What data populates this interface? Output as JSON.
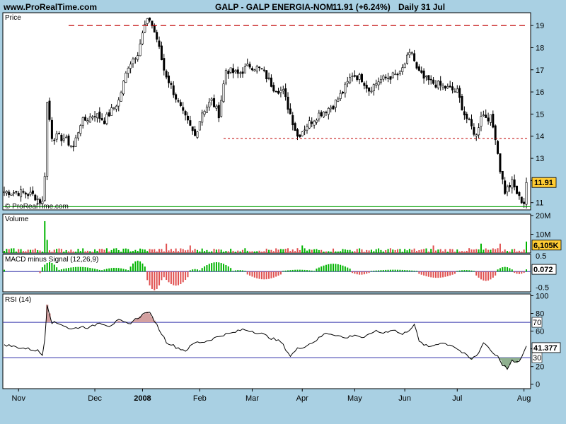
{
  "header": {
    "site": "www.ProRealTime.com",
    "title": "GALP - GALP ENERGIA-NOM",
    "price_change": "11.91 (+6.24%)",
    "period": "Daily  31 Jul"
  },
  "colors": {
    "background": "#a9d0e3",
    "panel": "#ffffff",
    "up": "#00b400",
    "down": "#e05050",
    "resistance": "#c00000",
    "support": "#00a000",
    "rsi_line": "#3333aa",
    "badge": "#ffcc33"
  },
  "chart_data": [
    {
      "type": "candlestick",
      "label": "Price",
      "credit": "© ProRealTime.com",
      "ylim": [
        10.8,
        19.45
      ],
      "yticks": [
        "11",
        "12",
        "13",
        "14",
        "15",
        "16",
        "17",
        "18",
        "19"
      ],
      "last_value": "11.91",
      "x_labels": [
        "Nov",
        "Dec",
        "2008",
        "Feb",
        "Mar",
        "Apr",
        "May",
        "Jun",
        "Jul",
        "Aug"
      ],
      "levels": [
        {
          "kind": "resistance",
          "value": 19.0
        },
        {
          "kind": "resistance",
          "value": 13.9
        },
        {
          "kind": "support",
          "value": 10.82
        }
      ],
      "close_path": [
        [
          0,
          11.5
        ],
        [
          7,
          11.45
        ],
        [
          12,
          11.35
        ],
        [
          16,
          11.0
        ],
        [
          17,
          12.3
        ],
        [
          18,
          15.5
        ],
        [
          20,
          14.0
        ],
        [
          25,
          13.9
        ],
        [
          29,
          13.5
        ],
        [
          32,
          14.6
        ],
        [
          38,
          15.0
        ],
        [
          42,
          14.7
        ],
        [
          48,
          15.6
        ],
        [
          52,
          17.2
        ],
        [
          56,
          17.8
        ],
        [
          59,
          19.0
        ],
        [
          61,
          19.3
        ],
        [
          64,
          18.4
        ],
        [
          67,
          17.0
        ],
        [
          71,
          16.0
        ],
        [
          75,
          15.0
        ],
        [
          80,
          14.0
        ],
        [
          83,
          15.1
        ],
        [
          87,
          15.6
        ],
        [
          90,
          15.0
        ],
        [
          93,
          17.0
        ],
        [
          98,
          16.8
        ],
        [
          103,
          17.2
        ],
        [
          108,
          17.0
        ],
        [
          113,
          16.2
        ],
        [
          117,
          16.0
        ],
        [
          120,
          15.0
        ],
        [
          123,
          14.0
        ],
        [
          127,
          14.5
        ],
        [
          132,
          15.0
        ],
        [
          138,
          15.4
        ],
        [
          142,
          16.0
        ],
        [
          146,
          16.8
        ],
        [
          150,
          16.6
        ],
        [
          153,
          16.1
        ],
        [
          157,
          16.5
        ],
        [
          162,
          16.7
        ],
        [
          166,
          16.8
        ],
        [
          169,
          17.5
        ],
        [
          171,
          17.8
        ],
        [
          173,
          17.0
        ],
        [
          176,
          16.6
        ],
        [
          180,
          16.4
        ],
        [
          185,
          16.2
        ],
        [
          190,
          16.0
        ],
        [
          193,
          15.0
        ],
        [
          196,
          14.4
        ],
        [
          198,
          14.0
        ],
        [
          200,
          15.0
        ],
        [
          204,
          14.8
        ],
        [
          206,
          14.0
        ],
        [
          208,
          12.5
        ],
        [
          210,
          11.5
        ],
        [
          213,
          11.9
        ],
        [
          216,
          11.2
        ],
        [
          218,
          11.0
        ],
        [
          219,
          11.91
        ]
      ]
    },
    {
      "type": "bar",
      "label": "Volume",
      "yticks": [
        "20M",
        "10M"
      ],
      "ylim": [
        0,
        20000000
      ],
      "last_value": "6,105K",
      "spikes": [
        [
          17,
          17
        ],
        [
          18,
          7
        ],
        [
          68,
          5
        ],
        [
          78,
          4
        ],
        [
          125,
          4
        ],
        [
          180,
          4
        ],
        [
          200,
          5
        ],
        [
          208,
          5
        ]
      ]
    },
    {
      "type": "bar",
      "label": "MACD minus Signal (12,26,9)",
      "yticks": [
        "0.5",
        "-0.5"
      ],
      "ylim": [
        -0.65,
        0.55
      ],
      "last_value": "0.072",
      "segments": [
        [
          0,
          1,
          0.06
        ],
        [
          15,
          16,
          -0.05
        ],
        [
          16,
          23,
          0.3
        ],
        [
          23,
          41,
          0.15
        ],
        [
          41,
          53,
          0.12
        ],
        [
          53,
          60,
          0.35
        ],
        [
          60,
          67,
          -0.6
        ],
        [
          67,
          78,
          -0.45
        ],
        [
          78,
          83,
          0.08
        ],
        [
          83,
          96,
          0.3
        ],
        [
          96,
          102,
          0.05
        ],
        [
          102,
          117,
          -0.25
        ],
        [
          117,
          131,
          0.06
        ],
        [
          131,
          146,
          0.25
        ],
        [
          146,
          154,
          -0.1
        ],
        [
          154,
          174,
          0.06
        ],
        [
          174,
          190,
          -0.2
        ],
        [
          190,
          198,
          0.05
        ],
        [
          198,
          207,
          -0.3
        ],
        [
          207,
          214,
          0.15
        ],
        [
          214,
          219,
          -0.08
        ],
        [
          219,
          220,
          0.07
        ]
      ]
    },
    {
      "type": "line",
      "label": "RSI (14)",
      "ylim": [
        -5,
        102
      ],
      "yticks": [
        "100",
        "80",
        "60",
        "40",
        "20",
        "0"
      ],
      "levels": [
        "70",
        "30"
      ],
      "last_value": "41.377",
      "values": [
        [
          0,
          45
        ],
        [
          5,
          42
        ],
        [
          10,
          40
        ],
        [
          14,
          38
        ],
        [
          16,
          33
        ],
        [
          17,
          52
        ],
        [
          18,
          90
        ],
        [
          20,
          70
        ],
        [
          24,
          68
        ],
        [
          28,
          62
        ],
        [
          32,
          65
        ],
        [
          36,
          64
        ],
        [
          40,
          70
        ],
        [
          44,
          66
        ],
        [
          48,
          72
        ],
        [
          52,
          68
        ],
        [
          56,
          75
        ],
        [
          60,
          82
        ],
        [
          61,
          80
        ],
        [
          63,
          72
        ],
        [
          65,
          62
        ],
        [
          68,
          48
        ],
        [
          72,
          42
        ],
        [
          76,
          38
        ],
        [
          80,
          47
        ],
        [
          84,
          48
        ],
        [
          88,
          52
        ],
        [
          92,
          56
        ],
        [
          96,
          58
        ],
        [
          100,
          62
        ],
        [
          104,
          60
        ],
        [
          108,
          57
        ],
        [
          112,
          52
        ],
        [
          116,
          48
        ],
        [
          118,
          40
        ],
        [
          120,
          32
        ],
        [
          123,
          40
        ],
        [
          127,
          44
        ],
        [
          131,
          50
        ],
        [
          135,
          58
        ],
        [
          139,
          56
        ],
        [
          143,
          52
        ],
        [
          147,
          56
        ],
        [
          151,
          52
        ],
        [
          155,
          60
        ],
        [
          159,
          58
        ],
        [
          163,
          62
        ],
        [
          167,
          56
        ],
        [
          170,
          62
        ],
        [
          172,
          68
        ],
        [
          174,
          48
        ],
        [
          178,
          42
        ],
        [
          183,
          47
        ],
        [
          188,
          44
        ],
        [
          192,
          36
        ],
        [
          196,
          28
        ],
        [
          199,
          35
        ],
        [
          201,
          48
        ],
        [
          203,
          42
        ],
        [
          205,
          35
        ],
        [
          207,
          32
        ],
        [
          209,
          22
        ],
        [
          211,
          18
        ],
        [
          213,
          26
        ],
        [
          215,
          24
        ],
        [
          217,
          30
        ],
        [
          219,
          42
        ]
      ]
    }
  ]
}
